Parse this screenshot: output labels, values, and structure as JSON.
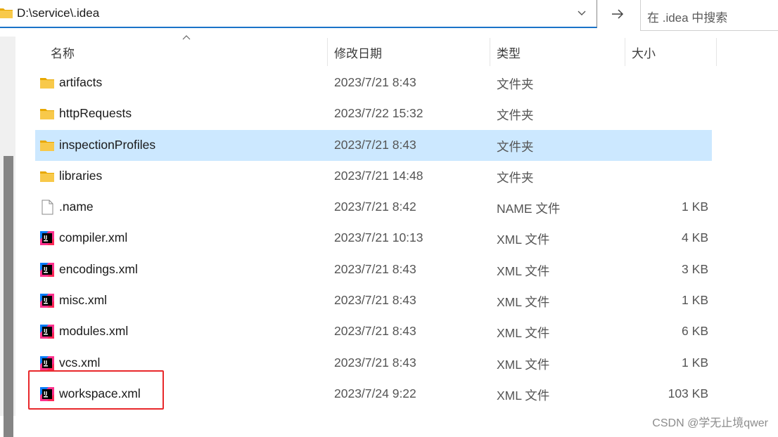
{
  "address_bar": {
    "path": "D:\\service\\.idea"
  },
  "search": {
    "placeholder": "在 .idea 中搜索"
  },
  "columns": {
    "name": "名称",
    "date": "修改日期",
    "type": "类型",
    "size": "大小"
  },
  "files": [
    {
      "name": "artifacts",
      "date": "2023/7/21 8:43",
      "type": "文件夹",
      "size": "",
      "icon": "folder-icon"
    },
    {
      "name": "httpRequests",
      "date": "2023/7/22 15:32",
      "type": "文件夹",
      "size": "",
      "icon": "folder-icon"
    },
    {
      "name": "inspectionProfiles",
      "date": "2023/7/21 8:43",
      "type": "文件夹",
      "size": "",
      "icon": "folder-icon",
      "selected": true
    },
    {
      "name": "libraries",
      "date": "2023/7/21 14:48",
      "type": "文件夹",
      "size": "",
      "icon": "folder-icon"
    },
    {
      "name": ".name",
      "date": "2023/7/21 8:42",
      "type": "NAME 文件",
      "size": "1 KB",
      "icon": "blank-file-icon"
    },
    {
      "name": "compiler.xml",
      "date": "2023/7/21 10:13",
      "type": "XML 文件",
      "size": "4 KB",
      "icon": "intellij-file-icon"
    },
    {
      "name": "encodings.xml",
      "date": "2023/7/21 8:43",
      "type": "XML 文件",
      "size": "3 KB",
      "icon": "intellij-file-icon"
    },
    {
      "name": "misc.xml",
      "date": "2023/7/21 8:43",
      "type": "XML 文件",
      "size": "1 KB",
      "icon": "intellij-file-icon"
    },
    {
      "name": "modules.xml",
      "date": "2023/7/21 8:43",
      "type": "XML 文件",
      "size": "6 KB",
      "icon": "intellij-file-icon"
    },
    {
      "name": "vcs.xml",
      "date": "2023/7/21 8:43",
      "type": "XML 文件",
      "size": "1 KB",
      "icon": "intellij-file-icon"
    },
    {
      "name": "workspace.xml",
      "date": "2023/7/24 9:22",
      "type": "XML 文件",
      "size": "103 KB",
      "icon": "intellij-file-icon"
    }
  ],
  "colors": {
    "selection": "#cce8ff",
    "highlight_border": "#e8282b",
    "folder": "#f8c94a",
    "accent": "#1a73c8"
  },
  "watermark": "CSDN @学无止境qwer"
}
